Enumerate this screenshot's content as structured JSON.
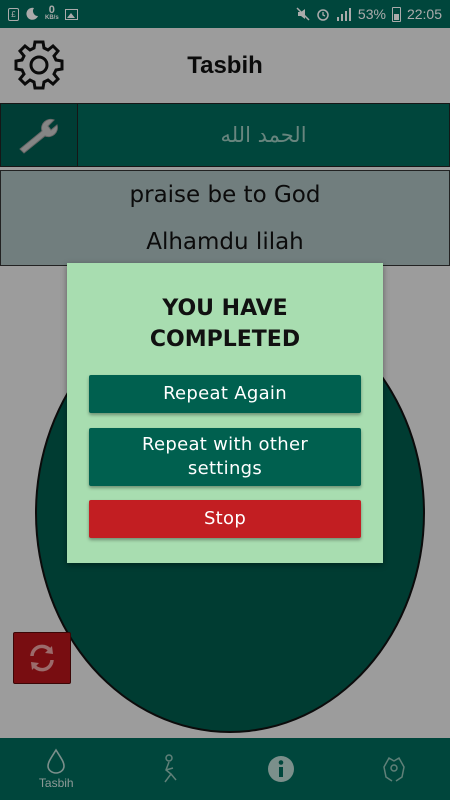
{
  "status_bar": {
    "net_speed": "0",
    "net_speed_unit": "KB/s",
    "mini_icon_text": "£",
    "battery_percent": "53%",
    "time": "22:05"
  },
  "header": {
    "title": "Tasbih"
  },
  "dhikr": {
    "arabic": "الحمد الله",
    "translation": "praise be to God",
    "transliteration": "Alhamdu lilah"
  },
  "dialog": {
    "title_line1": "YOU HAVE",
    "title_line2": "COMPLETED",
    "repeat_again": "Repeat Again",
    "repeat_other_line1": "Repeat with other",
    "repeat_other_line2": "settings",
    "stop": "Stop"
  },
  "bottom_nav": {
    "items": [
      {
        "label": "Tasbih",
        "icon": "drop-icon"
      },
      {
        "label": "",
        "icon": "praying-person-icon"
      },
      {
        "label": "",
        "icon": "info-icon"
      },
      {
        "label": "",
        "icon": "praying-hands-icon"
      }
    ]
  },
  "colors": {
    "primary_green": "#00695a",
    "dialog_bg": "#a8ddb0",
    "stop_red": "#c21e22"
  }
}
